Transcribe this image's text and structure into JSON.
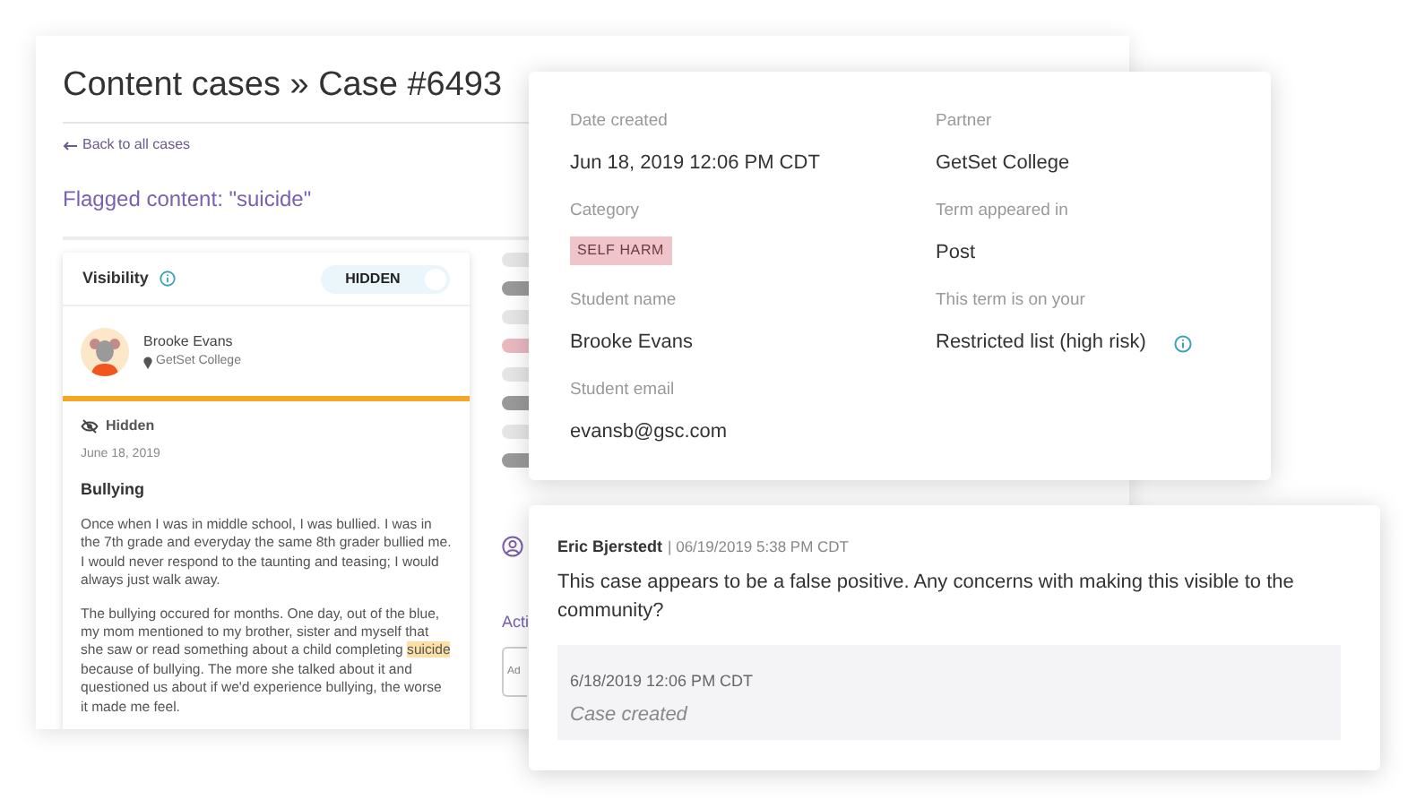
{
  "page": {
    "title": "Content cases » Case #6493",
    "back_link": "Back to all cases",
    "flagged": "Flagged content: \"suicide\"",
    "visibility": {
      "label": "Visibility",
      "toggle_label": "HIDDEN",
      "on": true
    },
    "student": {
      "name": "Brooke Evans",
      "school": "GetSet College"
    },
    "post": {
      "status": "Hidden",
      "date": "June 18, 2019",
      "title": "Bullying",
      "paragraphs": [
        [
          {
            "text": "Once when I was in middle school, I was bullied. I was in the 7th grade and everyday the same 8th grader bullied me. I would never respond to the taunting and teasing; I would always just walk away.",
            "kind": "plain"
          }
        ],
        [
          {
            "text": "The bullying occured for months. One day, out of the blue, my mom mentioned to my brother, sister and myself that she saw or read something about a child completing ",
            "kind": "plain"
          },
          {
            "text": "suicide",
            "kind": "flagged_term"
          },
          {
            "text": " because of bullying. The more she talked about it and questioned us about if we'd experience bullying, the worse it made me feel.",
            "kind": "plain"
          }
        ]
      ]
    },
    "actions_heading": "Acti",
    "note_placeholder": "Ad"
  },
  "details": {
    "columns": [
      [
        {
          "label": "Date created",
          "value": "Jun 18, 2019 12:06 PM CDT",
          "kind": "text"
        },
        {
          "label": "Category",
          "value": "SELF HARM",
          "kind": "tag"
        },
        {
          "label": "Student name",
          "value": "Brooke Evans",
          "kind": "text"
        },
        {
          "label": "Student email",
          "value": "evansb@gsc.com",
          "kind": "text"
        }
      ],
      [
        {
          "label": "Partner",
          "value": "GetSet College",
          "kind": "text"
        },
        {
          "label": "Term appeared in",
          "value": "Post",
          "kind": "text"
        },
        {
          "label": "This term is on your",
          "value": "Restricted list (high risk)",
          "kind": "info"
        }
      ]
    ]
  },
  "comments": [
    {
      "author": "Eric Bjerstedt",
      "time": "| 06/19/2019 5:38 PM CDT",
      "text": "This case appears to be a false positive. Any concerns with making this visible to the community?"
    }
  ],
  "history": [
    {
      "time": "6/18/2019 12:06 PM CDT",
      "event": "Case created"
    }
  ]
}
